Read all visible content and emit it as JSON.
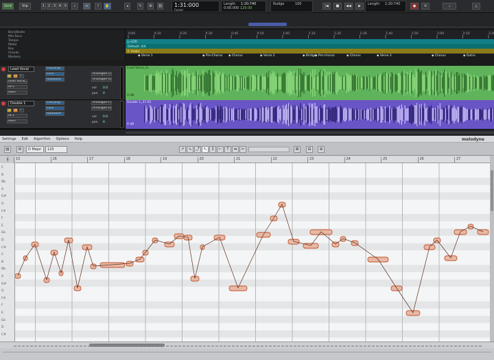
{
  "transport": {
    "buttons": [
      "Grid",
      "Slip",
      "1",
      "2",
      "3",
      "4",
      "5"
    ],
    "main_counter": "1:31:000",
    "length_label": "Length",
    "length_value": "1:20:740",
    "cursor_label": "Cursor",
    "cursor_value": "0:00.000",
    "bpm": "120.00",
    "nudge_label": "Nudge",
    "nudge_value": "100",
    "length2_label": "Length",
    "length2_value": "1:20:740"
  },
  "ruler_rows": [
    "Bars|Beats",
    "Min:Secs",
    "Tempo",
    "Meter",
    "Key",
    "Chords",
    "Markers"
  ],
  "time_ticks": [
    "0:00",
    "0:10",
    "0:20",
    "0:30",
    "0:40",
    "0:50",
    "1:00",
    "1:10",
    "1:20",
    "1:30",
    "1:40",
    "1:50",
    "2:00",
    "2:10",
    "2:20"
  ],
  "tempo_text": "J=120",
  "meter_text": "Default: 4/4",
  "key_text": "C major",
  "markers": [
    "Verse 1",
    "Pre-Chorus",
    "Chorus",
    "Verse 2",
    "Bridge",
    "Pre-chorus",
    "Chorus",
    "Verse 3",
    "Chorus",
    "Outro"
  ],
  "tracks": [
    {
      "name": "Lead Vocal",
      "clip": "Lead Vocal_2s",
      "gain": "0 dB",
      "input": "IN 1",
      "output": "Main",
      "inserts": [
        "ProComp",
        "FLTR",
        "Autotune"
      ],
      "plugins": [
        "Analogue CS",
        "Analogue EQ"
      ],
      "vol": "vol",
      "vol_value": "0.0",
      "pan": "pan",
      "pan_value": "0"
    },
    {
      "name": "Double 1",
      "clip": "Double 1_37.01",
      "gain": "0 dB",
      "input": "IN 1",
      "output": "Main",
      "inserts": [
        "ProComp",
        "FLTR",
        "Autotune"
      ],
      "plugins": [
        "Analogue CS",
        "Analogue EQ"
      ],
      "vol": "vol",
      "vol_value": "0.0",
      "pan": "pan",
      "pan_value": "0"
    }
  ],
  "melodyne": {
    "menus": [
      "Settings",
      "Edit",
      "Algorithm",
      "Options",
      "Help"
    ],
    "logo": "melodyne",
    "key_label": "D Major",
    "tempo_field": "120",
    "bar_numbers": [
      "15",
      "16",
      "17",
      "18",
      "19",
      "20",
      "21",
      "22",
      "23",
      "24",
      "25",
      "26",
      "27"
    ],
    "pitch_labels": [
      "C",
      "B",
      "Bb",
      "A",
      "G#",
      "G",
      "F#",
      "F",
      "E",
      "Eb",
      "D",
      "C#",
      "C",
      "B",
      "Bb",
      "A",
      "G#",
      "G",
      "F#",
      "F",
      "E",
      "Eb",
      "D",
      "C#"
    ]
  },
  "colors": {
    "green_track": "#5fb35a",
    "purple_track": "#6a55c7",
    "note_fill": "#e7b9a6",
    "note_edge": "#c2542c",
    "accent": "#2f90ff"
  }
}
